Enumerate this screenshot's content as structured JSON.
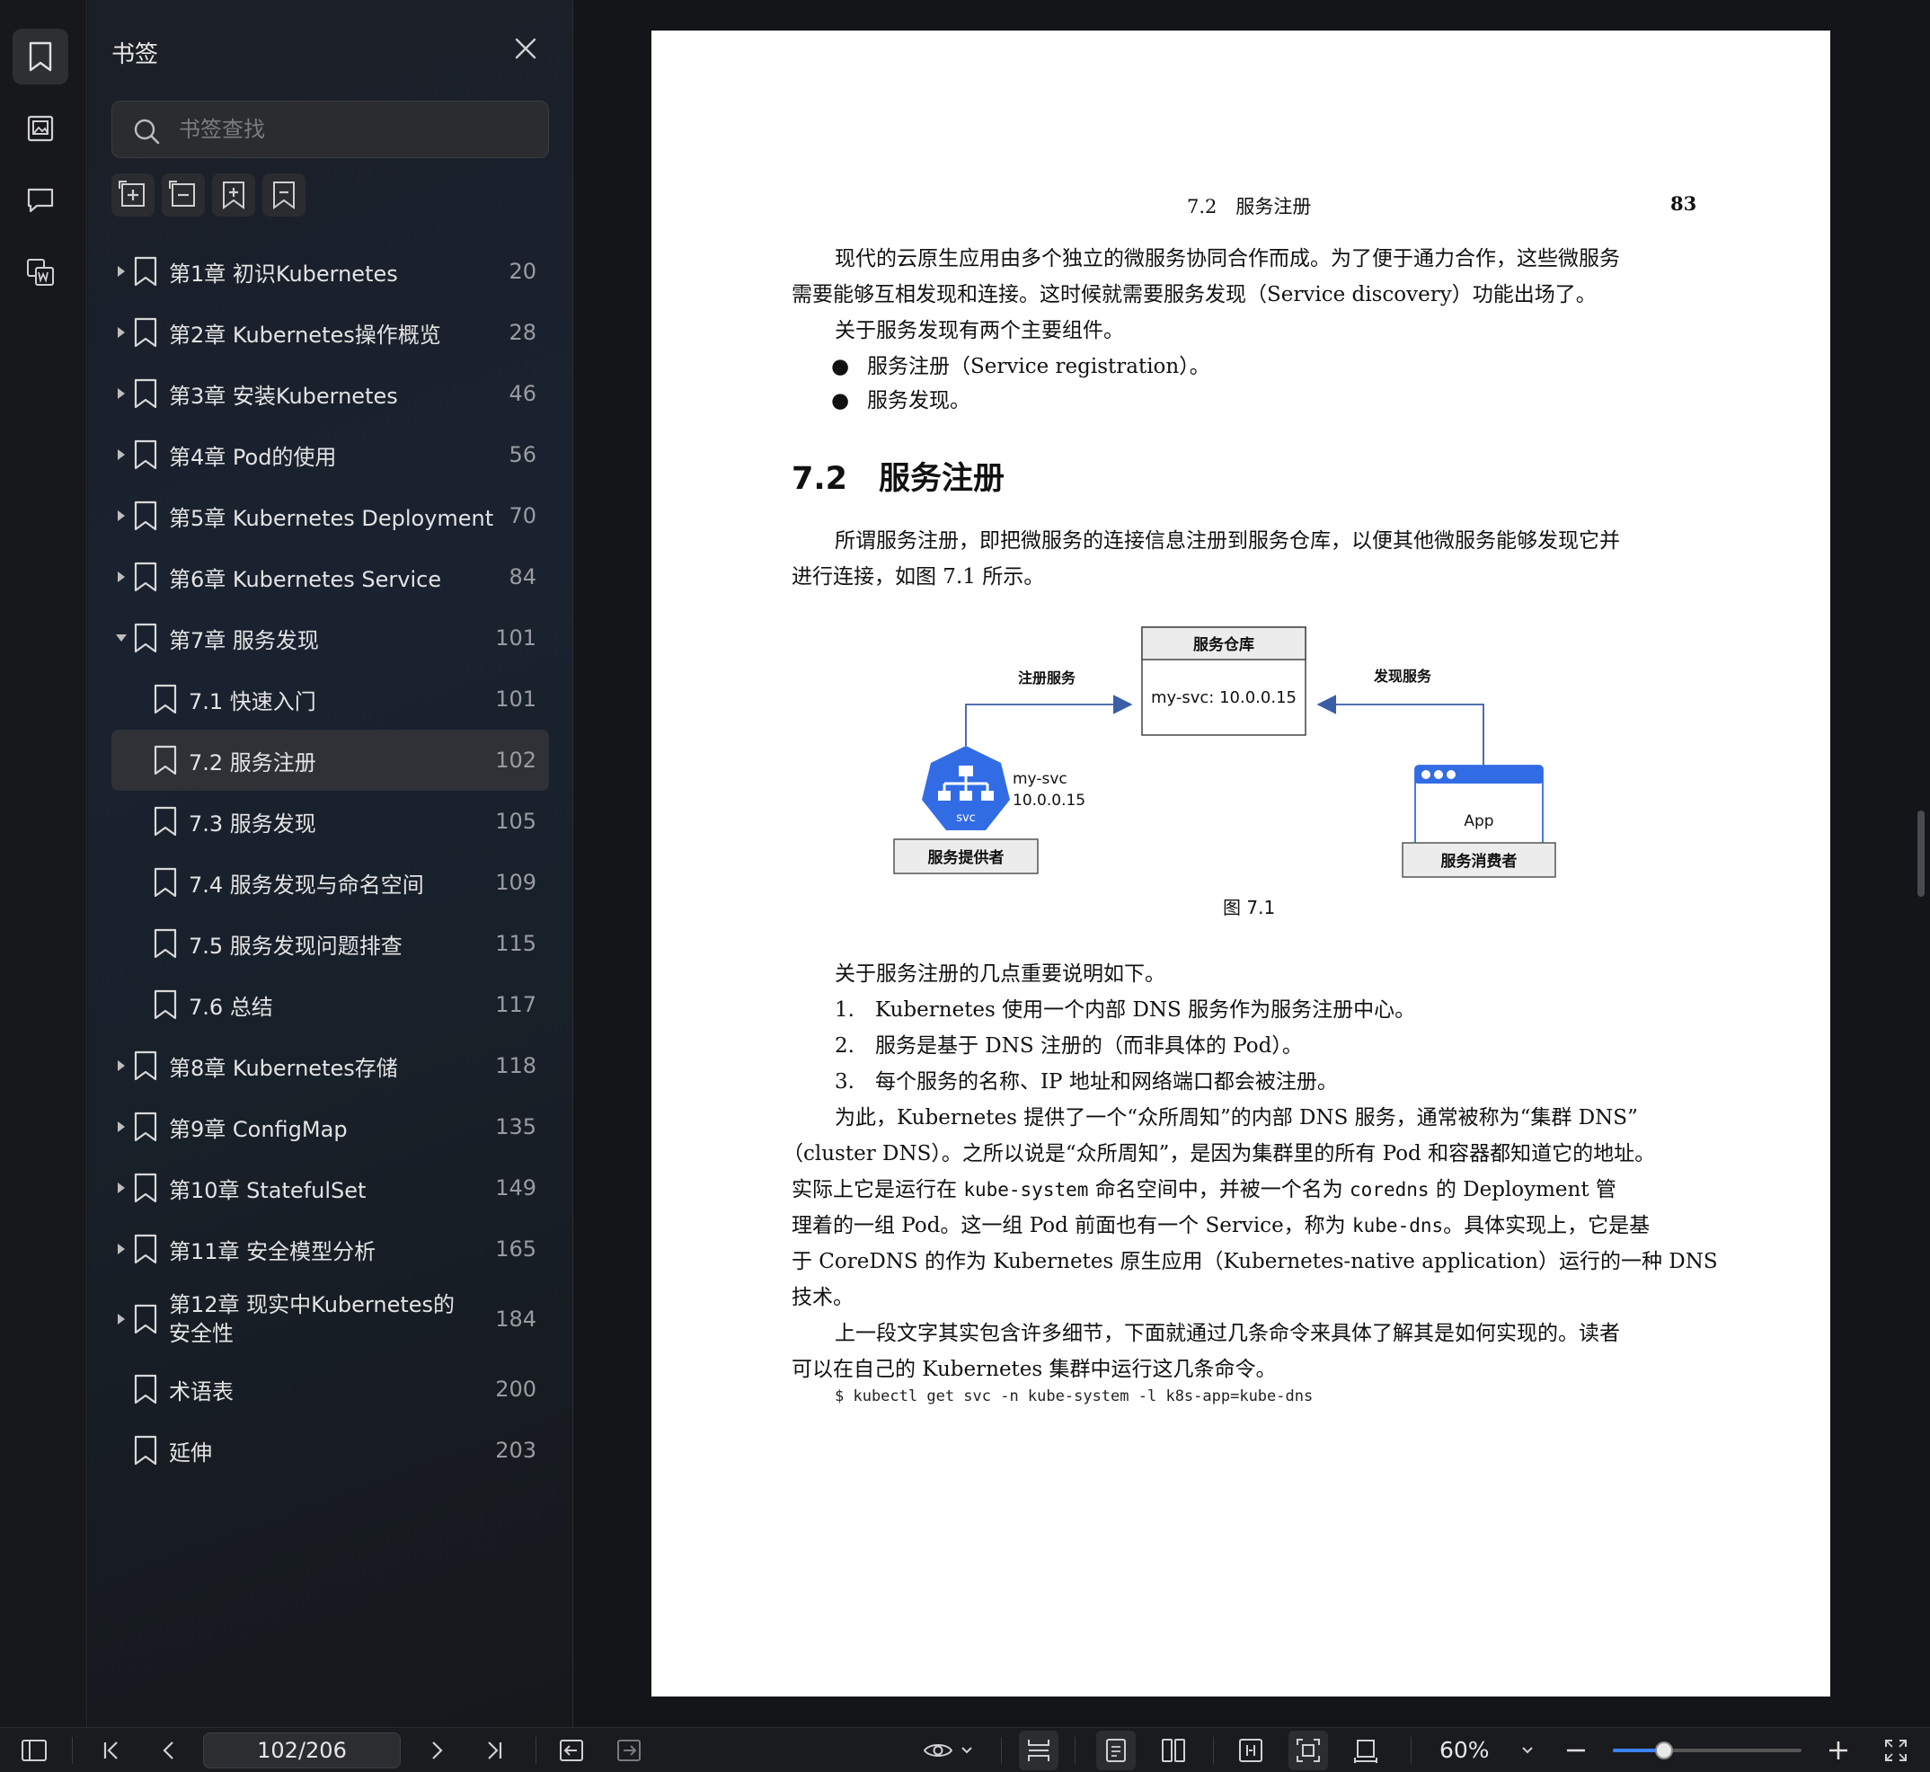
{
  "sidebar": {
    "title": "书签",
    "search_placeholder": "书签查找",
    "items": [
      {
        "label": "第1章 初识Kubernetes",
        "page": "20",
        "level": 0,
        "expandable": true,
        "expanded": false
      },
      {
        "label": "第2章 Kubernetes操作概览",
        "page": "28",
        "level": 0,
        "expandable": true,
        "expanded": false
      },
      {
        "label": "第3章 安装Kubernetes",
        "page": "46",
        "level": 0,
        "expandable": true,
        "expanded": false
      },
      {
        "label": "第4章 Pod的使用",
        "page": "56",
        "level": 0,
        "expandable": true,
        "expanded": false
      },
      {
        "label": "第5章 Kubernetes Deployment",
        "page": "70",
        "level": 0,
        "expandable": true,
        "expanded": false
      },
      {
        "label": "第6章 Kubernetes Service",
        "page": "84",
        "level": 0,
        "expandable": true,
        "expanded": false
      },
      {
        "label": "第7章 服务发现",
        "page": "101",
        "level": 0,
        "expandable": true,
        "expanded": true
      },
      {
        "label": "7.1 快速入门",
        "page": "101",
        "level": 1
      },
      {
        "label": "7.2 服务注册",
        "page": "102",
        "level": 1,
        "selected": true
      },
      {
        "label": "7.3 服务发现",
        "page": "105",
        "level": 1
      },
      {
        "label": "7.4 服务发现与命名空间",
        "page": "109",
        "level": 1
      },
      {
        "label": "7.5 服务发现问题排查",
        "page": "115",
        "level": 1
      },
      {
        "label": "7.6 总结",
        "page": "117",
        "level": 1
      },
      {
        "label": "第8章 Kubernetes存储",
        "page": "118",
        "level": 0,
        "expandable": true,
        "expanded": false
      },
      {
        "label": "第9章 ConfigMap",
        "page": "135",
        "level": 0,
        "expandable": true,
        "expanded": false
      },
      {
        "label": "第10章 StatefulSet",
        "page": "149",
        "level": 0,
        "expandable": true,
        "expanded": false
      },
      {
        "label": "第11章 安全模型分析",
        "page": "165",
        "level": 0,
        "expandable": true,
        "expanded": false
      },
      {
        "label": "第12章 现实中Kubernetes的安全性",
        "page": "184",
        "level": 0,
        "expandable": true,
        "expanded": false,
        "tall": true
      },
      {
        "label": "术语表",
        "page": "200",
        "level": 0,
        "expandable": false
      },
      {
        "label": "延伸",
        "page": "203",
        "level": 0,
        "expandable": false
      }
    ]
  },
  "page": {
    "running_head": "7.2　服务注册",
    "page_number": "83",
    "intro_p1_l1": "现代的云原生应用由多个独立的微服务协同合作而成。为了便于通力合作，这些微服务",
    "intro_p1_l2": "需要能够互相发现和连接。这时候就需要服务发现（Service discovery）功能出场了。",
    "intro_p2": "关于服务发现有两个主要组件。",
    "bullet1": "服务注册（Service registration）。",
    "bullet2": "服务发现。",
    "heading": "7.2　服务注册",
    "p3_l1": "所谓服务注册，即把微服务的连接信息注册到服务仓库，以便其他微服务能够发现它并",
    "p3_l2": "进行连接，如图 7.1 所示。",
    "figure": {
      "registry_title": "服务仓库",
      "registry_entry": "my-svc: 10.0.0.15",
      "register_label": "注册服务",
      "discover_label": "发现服务",
      "svc_name": "my-svc",
      "svc_ip": "10.0.0.15",
      "svc_badge": "svc",
      "provider_label": "服务提供者",
      "app_label": "App",
      "consumer_label": "服务消费者",
      "caption": "图 7.1"
    },
    "p4": "关于服务注册的几点重要说明如下。",
    "list1": "1.　Kubernetes 使用一个内部 DNS 服务作为服务注册中心。",
    "list2": "2.　服务是基于 DNS 注册的（而非具体的 Pod）。",
    "list3": "3.　每个服务的名称、IP 地址和网络端口都会被注册。",
    "p5_l1": "为此，Kubernetes 提供了一个“众所周知”的内部 DNS 服务，通常被称为“集群 DNS”",
    "p5_l2": "（cluster DNS）。之所以说是“众所周知”，是因为集群里的所有 Pod 和容器都知道它的地址。",
    "p5_l3_a": "实际上它是运行在 ",
    "p5_l3_code1": "kube-system",
    "p5_l3_b": " 命名空间中，并被一个名为 ",
    "p5_l3_code2": "coredns",
    "p5_l3_c": " 的 Deployment 管",
    "p5_l4_a": "理着的一组 Pod。这一组 Pod 前面也有一个 Service，称为 ",
    "p5_l4_code": "kube-dns",
    "p5_l4_b": "。具体实现上，它是基",
    "p5_l5": "于 CoreDNS 的作为 Kubernetes 原生应用（Kubernetes-native application）运行的一种 DNS",
    "p5_l6": "技术。",
    "p6_l1": "上一段文字其实包含许多细节，下面就通过几条命令来具体了解其是如何实现的。读者",
    "p6_l2": "可以在自己的 Kubernetes 集群中运行这几条命令。",
    "command": "$ kubectl get svc -n kube-system -l k8s-app=kube-dns"
  },
  "toolbar": {
    "page_indicator": "102/206",
    "zoom": "60%",
    "zoom_fraction": 0.27
  },
  "colors": {
    "accent": "#3b82f6",
    "k8s_blue": "#326ce5",
    "diagram_arrow": "#3a5da8"
  }
}
